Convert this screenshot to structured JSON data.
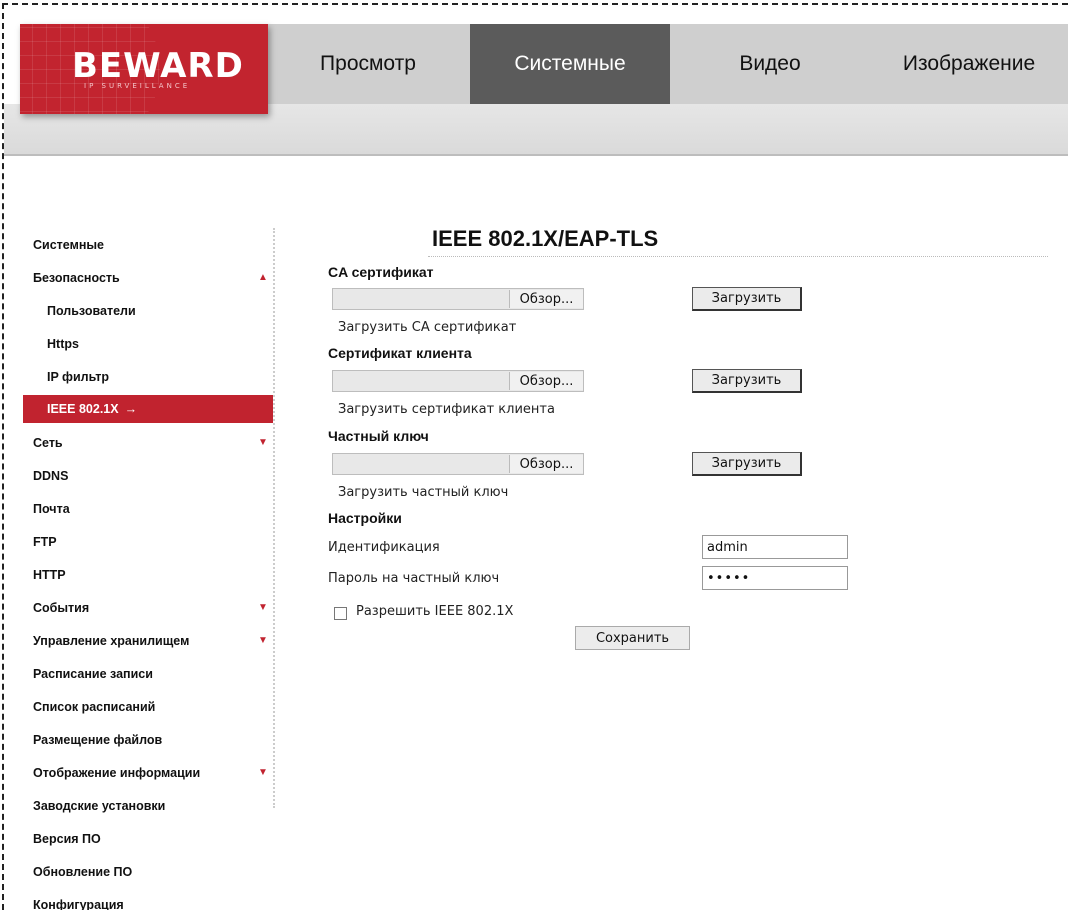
{
  "logo": {
    "brand": "BEWARD",
    "tagline": "IP SURVEILLANCE"
  },
  "nav": {
    "tabs": [
      {
        "label": "Просмотр"
      },
      {
        "label": "Системные",
        "active": true
      },
      {
        "label": "Видео"
      },
      {
        "label": "Изображение"
      }
    ]
  },
  "sidebar": {
    "items": [
      {
        "label": "Системные"
      },
      {
        "label": "Безопасность",
        "arrow": "▲"
      },
      {
        "label": "Пользователи"
      },
      {
        "label": "Https"
      },
      {
        "label": "IP фильтр"
      },
      {
        "label": "IEEE 802.1X",
        "active": true,
        "arrow": "→"
      },
      {
        "label": "Сеть",
        "arrow": "▼"
      },
      {
        "label": "DDNS"
      },
      {
        "label": "Почта"
      },
      {
        "label": "FTP"
      },
      {
        "label": "HTTP"
      },
      {
        "label": "События",
        "arrow": "▼"
      },
      {
        "label": "Управление хранилищем",
        "arrow": "▼"
      },
      {
        "label": "Расписание записи"
      },
      {
        "label": "Список расписаний"
      },
      {
        "label": "Размещение файлов"
      },
      {
        "label": "Отображение информации",
        "arrow": "▼"
      },
      {
        "label": "Заводские установки"
      },
      {
        "label": "Версия ПО"
      },
      {
        "label": "Обновление ПО"
      },
      {
        "label": "Конфигурация"
      }
    ]
  },
  "main": {
    "title": "IEEE 802.1X/EAP-TLS",
    "ca": {
      "label": "CA сертификат",
      "browse": "Обзор...",
      "upload": "Загрузить",
      "hint": "Загрузить CA сертификат"
    },
    "client": {
      "label": "Сертификат клиента",
      "browse": "Обзор...",
      "upload": "Загрузить",
      "hint": "Загрузить сертификат клиента"
    },
    "key": {
      "label": "Частный ключ",
      "browse": "Обзор...",
      "upload": "Загрузить",
      "hint": "Загрузить частный ключ"
    },
    "settings": {
      "label": "Настройки",
      "identity_label": "Идентификация",
      "identity_value": "admin",
      "password_label": "Пароль на частный ключ",
      "password_value": "•••••",
      "enable_label": "Разрешить IEEE 802.1X",
      "enable_checked": false,
      "save": "Сохранить"
    }
  },
  "colors": {
    "brand_red": "#c1232f",
    "active_tab": "#5b5b5b",
    "nav_bg": "#cfcfcf"
  }
}
